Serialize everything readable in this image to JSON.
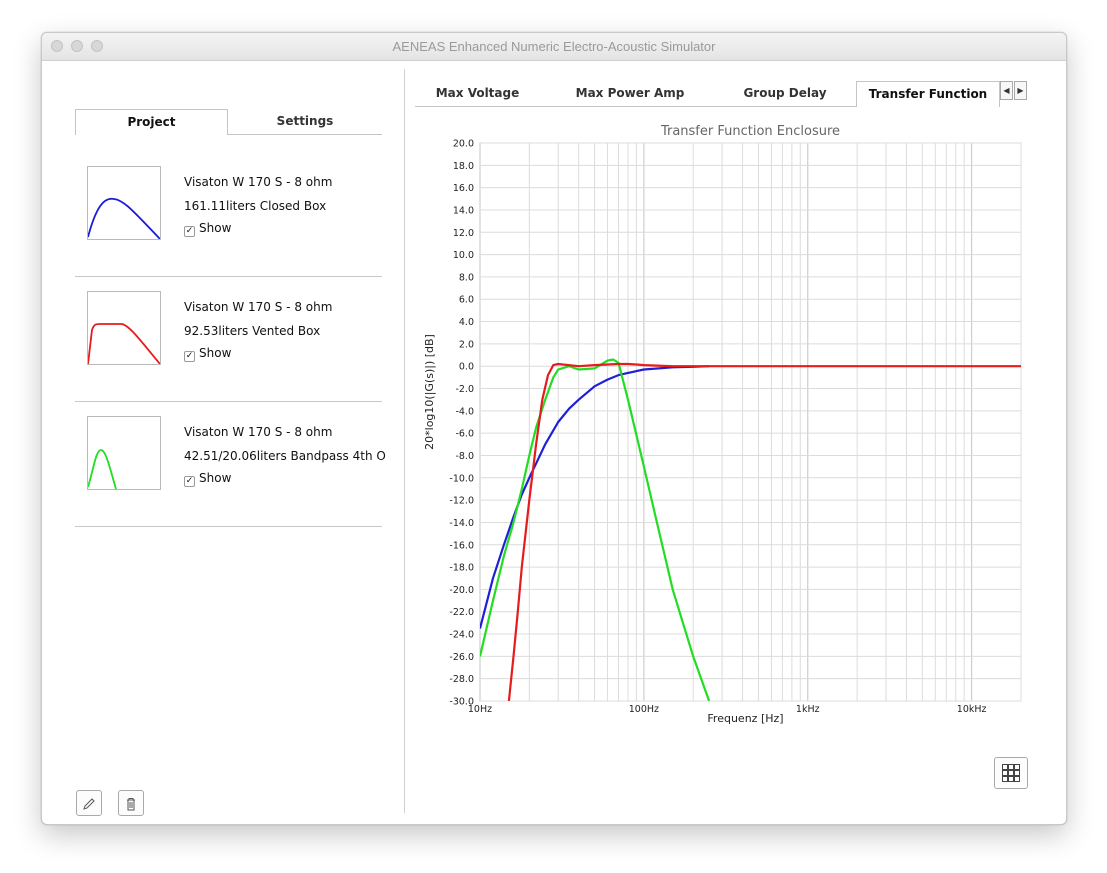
{
  "window": {
    "title": "AENEAS Enhanced Numeric Electro-Acoustic Simulator"
  },
  "left_tabs": [
    {
      "label": "Project",
      "active": true
    },
    {
      "label": "Settings",
      "active": false
    }
  ],
  "projects": [
    {
      "line1": "Visaton W 170 S - 8 ohm",
      "line2": "161.11liters Closed Box",
      "show_label": "Show",
      "show_checked": true,
      "color": "#1a1adb"
    },
    {
      "line1": "Visaton W 170 S - 8 ohm",
      "line2": "92.53liters Vented Box",
      "show_label": "Show",
      "show_checked": true,
      "color": "#e61c1c"
    },
    {
      "line1": "Visaton W 170 S - 8 ohm",
      "line2": "42.51/20.06liters Bandpass 4th O",
      "show_label": "Show",
      "show_checked": true,
      "color": "#22dd22"
    }
  ],
  "bottom_buttons": {
    "edit_icon": "pencil-icon",
    "delete_icon": "trash-icon"
  },
  "right_tabs": [
    {
      "label": "Max Voltage",
      "active": false
    },
    {
      "label": "Max Power Amp",
      "active": false
    },
    {
      "label": "Group Delay",
      "active": false
    },
    {
      "label": "Transfer Function",
      "active": true
    }
  ],
  "tab_scroll": {
    "left_icon": "arrow-left-icon",
    "right_icon": "arrow-right-icon",
    "left_glyph": "◀",
    "right_glyph": "▶"
  },
  "layout_button_icon": "grid-layout-icon",
  "chart_data": {
    "type": "line",
    "title": "Transfer Function Enclosure",
    "xlabel": "Frequenz [Hz]",
    "ylabel": "20*log10(|G(s)|) [dB]",
    "xscale": "log",
    "xlim": [
      10,
      20000
    ],
    "ylim": [
      -30,
      20
    ],
    "xticks": [
      {
        "value": 10,
        "label": "10Hz"
      },
      {
        "value": 100,
        "label": "100Hz"
      },
      {
        "value": 1000,
        "label": "1kHz"
      },
      {
        "value": 10000,
        "label": "10kHz"
      }
    ],
    "yticks": [
      "20.0",
      "18.0",
      "16.0",
      "14.0",
      "12.0",
      "10.0",
      "8.0",
      "6.0",
      "4.0",
      "2.0",
      "0.0",
      "-2.0",
      "-4.0",
      "-6.0",
      "-8.0",
      "-10.0",
      "-12.0",
      "-14.0",
      "-16.0",
      "-18.0",
      "-20.0",
      "-22.0",
      "-24.0",
      "-26.0",
      "-28.0",
      "-30.0"
    ],
    "grid": true,
    "series": [
      {
        "color": "#1f1fd6",
        "x": [
          10,
          12,
          14,
          16,
          18,
          20,
          25,
          30,
          35,
          40,
          50,
          60,
          70,
          80,
          100,
          150,
          200,
          250
        ],
        "y": [
          -23.5,
          -19,
          -16,
          -13.5,
          -11.5,
          -10,
          -7,
          -5,
          -3.8,
          -3,
          -1.8,
          -1.2,
          -0.8,
          -0.6,
          -0.3,
          -0.1,
          -0.05,
          0
        ]
      },
      {
        "color": "#22dd22",
        "x": [
          10,
          12,
          14,
          16,
          18,
          20,
          22,
          25,
          28,
          30,
          35,
          40,
          50,
          60,
          65,
          70,
          80,
          100,
          120,
          150,
          200,
          250
        ],
        "y": [
          -26,
          -21,
          -17,
          -14,
          -11,
          -8,
          -5.5,
          -3,
          -1,
          -0.3,
          0,
          -0.3,
          -0.2,
          0.5,
          0.6,
          0.3,
          -3,
          -9,
          -14,
          -20,
          -26,
          -30
        ]
      },
      {
        "color": "#e61c1c",
        "x": [
          15,
          16,
          17,
          18,
          20,
          22,
          24,
          26,
          28,
          30,
          40,
          50,
          60,
          70,
          80,
          90,
          100,
          120,
          150,
          200,
          500,
          1000,
          20000
        ],
        "y": [
          -30,
          -26,
          -22,
          -18,
          -12,
          -7,
          -3,
          -0.8,
          0.1,
          0.2,
          0,
          0.1,
          0.15,
          0.2,
          0.2,
          0.15,
          0.1,
          0.05,
          0,
          0,
          0,
          0,
          0
        ]
      }
    ]
  }
}
